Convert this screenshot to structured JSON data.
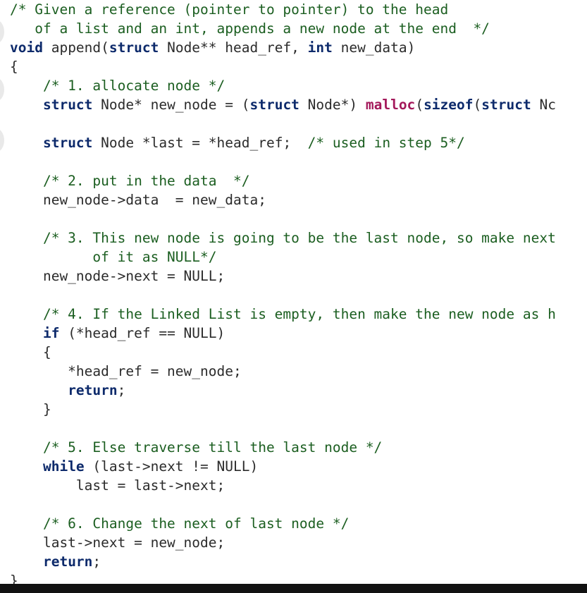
{
  "code": {
    "lines": [
      [
        {
          "t": "/* Given a reference (pointer to pointer) to the head",
          "c": "cm"
        }
      ],
      [
        {
          "t": "   of a list and an int, appends a new node at the end  */",
          "c": "cm"
        }
      ],
      [
        {
          "t": "void",
          "c": "kw"
        },
        {
          "t": " append(",
          "c": "tx"
        },
        {
          "t": "struct",
          "c": "kw"
        },
        {
          "t": " Node** head_ref, ",
          "c": "tx"
        },
        {
          "t": "int",
          "c": "kw"
        },
        {
          "t": " new_data)",
          "c": "tx"
        }
      ],
      [
        {
          "t": "{",
          "c": "tx"
        }
      ],
      [
        {
          "t": "    /* 1. allocate node */",
          "c": "cm"
        }
      ],
      [
        {
          "t": "    ",
          "c": "tx"
        },
        {
          "t": "struct",
          "c": "kw"
        },
        {
          "t": " Node* new_node = (",
          "c": "tx"
        },
        {
          "t": "struct",
          "c": "kw"
        },
        {
          "t": " Node*) ",
          "c": "tx"
        },
        {
          "t": "malloc",
          "c": "fn"
        },
        {
          "t": "(",
          "c": "tx"
        },
        {
          "t": "sizeof",
          "c": "kw"
        },
        {
          "t": "(",
          "c": "tx"
        },
        {
          "t": "struct",
          "c": "kw"
        },
        {
          "t": " Nc",
          "c": "tx"
        }
      ],
      [],
      [
        {
          "t": "    ",
          "c": "tx"
        },
        {
          "t": "struct",
          "c": "kw"
        },
        {
          "t": " Node *last = *head_ref;  ",
          "c": "tx"
        },
        {
          "t": "/* used in step 5*/",
          "c": "cm"
        }
      ],
      [],
      [
        {
          "t": "    /* 2. put in the data  */",
          "c": "cm"
        }
      ],
      [
        {
          "t": "    new_node->data  = new_data;",
          "c": "tx"
        }
      ],
      [],
      [
        {
          "t": "    /* 3. This new node is going to be the last node, so make next",
          "c": "cm"
        }
      ],
      [
        {
          "t": "          of it as NULL*/",
          "c": "cm"
        }
      ],
      [
        {
          "t": "    new_node->next = NULL;",
          "c": "tx"
        }
      ],
      [],
      [
        {
          "t": "    /* 4. If the Linked List is empty, then make the new node as h",
          "c": "cm"
        }
      ],
      [
        {
          "t": "    ",
          "c": "tx"
        },
        {
          "t": "if",
          "c": "kw"
        },
        {
          "t": " (*head_ref == NULL)",
          "c": "tx"
        }
      ],
      [
        {
          "t": "    {",
          "c": "tx"
        }
      ],
      [
        {
          "t": "       *head_ref = new_node;",
          "c": "tx"
        }
      ],
      [
        {
          "t": "       ",
          "c": "tx"
        },
        {
          "t": "return",
          "c": "kw"
        },
        {
          "t": ";",
          "c": "tx"
        }
      ],
      [
        {
          "t": "    }",
          "c": "tx"
        }
      ],
      [],
      [
        {
          "t": "    /* 5. Else traverse till the last node */",
          "c": "cm"
        }
      ],
      [
        {
          "t": "    ",
          "c": "tx"
        },
        {
          "t": "while",
          "c": "kw"
        },
        {
          "t": " (last->next != NULL)",
          "c": "tx"
        }
      ],
      [
        {
          "t": "        last = last->next;",
          "c": "tx"
        }
      ],
      [],
      [
        {
          "t": "    /* 6. Change the next of last node */",
          "c": "cm"
        }
      ],
      [
        {
          "t": "    last->next = new_node;",
          "c": "tx"
        }
      ],
      [
        {
          "t": "    ",
          "c": "tx"
        },
        {
          "t": "return",
          "c": "kw"
        },
        {
          "t": ";",
          "c": "tx"
        }
      ],
      [
        {
          "t": "}",
          "c": "tx"
        }
      ]
    ]
  }
}
